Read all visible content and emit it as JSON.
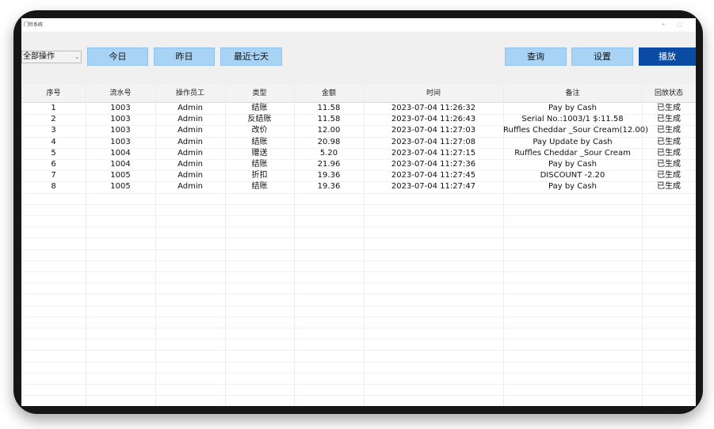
{
  "app": {
    "title": "门铃系统",
    "minimize_glyph": "–",
    "maximize_glyph": "□"
  },
  "toolbar": {
    "filter_value": "全部操作",
    "today": "今日",
    "yesterday": "昨日",
    "last7": "最近七天",
    "query": "查询",
    "settings": "设置",
    "play": "播放"
  },
  "colors": {
    "button_light": "#a9d3f5",
    "button_dark": "#0a4ca4"
  },
  "table": {
    "columns": [
      "序号",
      "流水号",
      "操作员工",
      "类型",
      "金额",
      "时间",
      "备注",
      "回放状态"
    ],
    "rows": [
      [
        "1",
        "1003",
        "Admin",
        "结账",
        "11.58",
        "2023-07-04 11:26:32",
        "Pay by Cash",
        "已生成"
      ],
      [
        "2",
        "1003",
        "Admin",
        "反结账",
        "11.58",
        "2023-07-04 11:26:43",
        "Serial No.:1003/1  $:11.58",
        "已生成"
      ],
      [
        "3",
        "1003",
        "Admin",
        "改价",
        "12.00",
        "2023-07-04 11:27:03",
        "Ruffles Cheddar _Sour Cream(12.00)",
        "已生成"
      ],
      [
        "4",
        "1003",
        "Admin",
        "结账",
        "20.98",
        "2023-07-04 11:27:08",
        "Pay Update by Cash",
        "已生成"
      ],
      [
        "5",
        "1004",
        "Admin",
        "赠送",
        "5.20",
        "2023-07-04 11:27:15",
        "Ruffles Cheddar _Sour Cream",
        "已生成"
      ],
      [
        "6",
        "1004",
        "Admin",
        "结账",
        "21.96",
        "2023-07-04 11:27:36",
        "Pay by Cash",
        "已生成"
      ],
      [
        "7",
        "1005",
        "Admin",
        "折扣",
        "19.36",
        "2023-07-04 11:27:45",
        "DISCOUNT -2.20",
        "已生成"
      ],
      [
        "8",
        "1005",
        "Admin",
        "结账",
        "19.36",
        "2023-07-04 11:27:47",
        "Pay by Cash",
        "已生成"
      ]
    ]
  }
}
